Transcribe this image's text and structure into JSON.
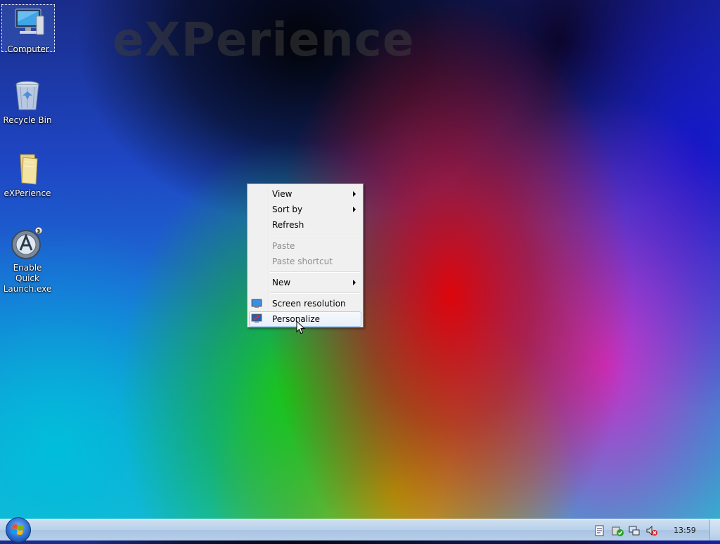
{
  "watermark": "eXPerience",
  "desktop_icons": [
    {
      "label": "Computer"
    },
    {
      "label": "Recycle Bin"
    },
    {
      "label": "eXPerience"
    },
    {
      "label": "Enable Quick Launch.exe"
    }
  ],
  "context_menu": {
    "items": [
      {
        "label": "View",
        "submenu": true,
        "enabled": true
      },
      {
        "label": "Sort by",
        "submenu": true,
        "enabled": true
      },
      {
        "label": "Refresh",
        "submenu": false,
        "enabled": true
      },
      {
        "label": "Paste",
        "submenu": false,
        "enabled": false
      },
      {
        "label": "Paste shortcut",
        "submenu": false,
        "enabled": false
      },
      {
        "label": "New",
        "submenu": true,
        "enabled": true
      },
      {
        "label": "Screen resolution",
        "submenu": false,
        "enabled": true,
        "icon": "display-icon"
      },
      {
        "label": "Personalize",
        "submenu": false,
        "enabled": true,
        "icon": "personalize-icon",
        "highlighted": true
      }
    ]
  },
  "taskbar": {
    "clock": "13:59",
    "tray_icons": [
      "action-center-icon",
      "security-check-icon",
      "network-icon",
      "volume-muted-icon"
    ]
  },
  "colors": {
    "menu_bg": "#f0f0f0",
    "menu_hover_border": "#aecff7",
    "taskbar_bg": "#b8d0ea",
    "disabled_text": "#8d8d8d"
  }
}
